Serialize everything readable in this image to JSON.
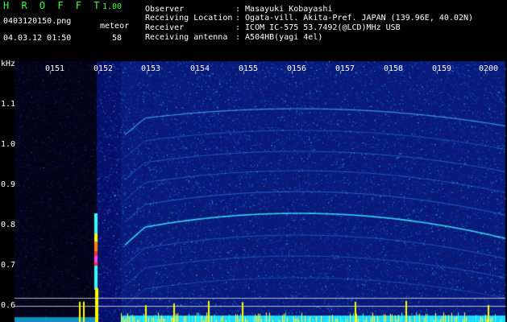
{
  "header": {
    "app_title": "H R O F F T",
    "version": "1.00",
    "filename": "0403120150.png",
    "meteor_label": "meteor",
    "datetime": "04.03.12 01:50",
    "meteor_count": "58"
  },
  "info": {
    "observer_label": "Observer",
    "observer_value": ": Masayuki Kobayashi",
    "location_label": "Receiving Location",
    "location_value": ": Ogata-vill. Akita-Pref. JAPAN (139.96E, 40.02N)",
    "receiver_label": "Receiver",
    "receiver_value": ": ICOM IC-575 53.7492(@LCD)MHz USB",
    "antenna_label": "Receiving antenna",
    "antenna_value": ": A504HB(yagi 4el)"
  },
  "axis": {
    "y_unit": "kHz",
    "y_ticks": [
      "1.1",
      "1.0",
      "0.9",
      "0.8",
      "0.7",
      "0.6"
    ],
    "x_ticks": [
      "0151",
      "0152",
      "0153",
      "0154",
      "0155",
      "0156",
      "0157",
      "0158",
      "0159",
      "0200"
    ]
  },
  "colors": {
    "title_green": "#3cff3c",
    "background_blue": "#0a1a8a",
    "signal_cyan": "#30ffff",
    "signal_yellow": "#ffff00"
  }
}
